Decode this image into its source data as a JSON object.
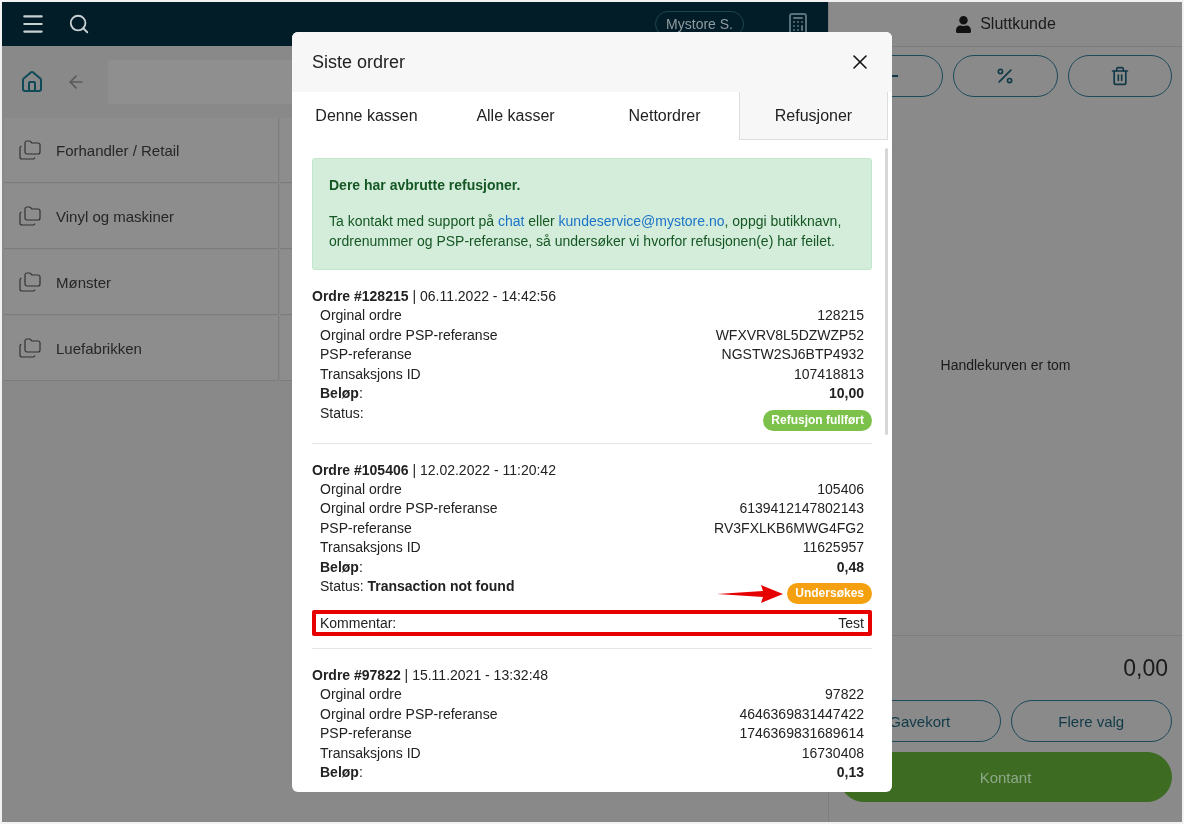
{
  "topbar": {
    "store_button": "Mystore S."
  },
  "categories": [
    {
      "label": "Forhandler / Retail"
    },
    {
      "label": "Vinyl og maskiner"
    },
    {
      "label": "Mønster"
    },
    {
      "label": "Luefabrikken"
    }
  ],
  "cart": {
    "customer": "Sluttkunde",
    "empty_message": "Handlekurven er tom",
    "total": "0,00",
    "buttons": [
      {
        "label": "Gavekort",
        "kind": "outline"
      },
      {
        "label": "Flere valg",
        "kind": "outline"
      },
      {
        "label": "Kontant",
        "kind": "primary"
      }
    ]
  },
  "modal": {
    "title": "Siste ordrer",
    "tabs": [
      {
        "label": "Denne kassen",
        "selected": false
      },
      {
        "label": "Alle kasser",
        "selected": false
      },
      {
        "label": "Nettordrer",
        "selected": false
      },
      {
        "label": "Refusjoner",
        "selected": true
      }
    ],
    "alert": {
      "title": "Dere har avbrutte refusjoner.",
      "message": [
        {
          "kind": "text",
          "text": "Ta kontakt med support på "
        },
        {
          "kind": "link",
          "text": "chat"
        },
        {
          "kind": "text",
          "text": " eller "
        },
        {
          "kind": "link",
          "text": "kundeservice@mystore.no"
        },
        {
          "kind": "text",
          "text": ", oppgi butikknavn, ordrenummer og PSP-referanse, så undersøker vi hvorfor refusjonen(e) har feilet."
        }
      ]
    },
    "orders": [
      {
        "header": "**Ordre #128215** | 06.11.2022 - 14:42:56",
        "rows": [
          {
            "label": "Orginal ordre",
            "value": "128215",
            "kind": "plain"
          },
          {
            "label": "Orginal ordre PSP-referanse",
            "value": "WFXVRV8L5DZWZP52",
            "kind": "plain"
          },
          {
            "label": "PSP-referanse",
            "value": "NGSTW2SJ6BTP4932",
            "kind": "plain"
          },
          {
            "label": "Transaksjons ID",
            "value": "107418813",
            "kind": "plain"
          },
          {
            "label": "**Beløp**:",
            "value": "10,00",
            "kind": "amount"
          }
        ],
        "status": {
          "label": "Status:",
          "badge": "Refusjon fullført",
          "color": "#7cc24a",
          "arrow": false
        }
      },
      {
        "header": "**Ordre #105406** | 12.02.2022 - 11:20:42",
        "rows": [
          {
            "label": "Orginal ordre",
            "value": "105406",
            "kind": "plain"
          },
          {
            "label": "Orginal ordre PSP-referanse",
            "value": "6139412147802143",
            "kind": "plain"
          },
          {
            "label": "PSP-referanse",
            "value": "RV3FXLKB6MWG4FG2",
            "kind": "plain"
          },
          {
            "label": "Transaksjons ID",
            "value": "11625957",
            "kind": "plain"
          },
          {
            "label": "**Beløp**:",
            "value": "0,48",
            "kind": "amount"
          }
        ],
        "status": {
          "label": "Status: **Transaction not found**",
          "badge": "Undersøkes",
          "color": "#f5a00f",
          "arrow": true
        },
        "comment": {
          "label": "Kommentar:",
          "value": "Test",
          "highlighted": true
        }
      },
      {
        "header": "**Ordre #97822** | 15.11.2021 - 13:32:48",
        "rows": [
          {
            "label": "Orginal ordre",
            "value": "97822",
            "kind": "plain"
          },
          {
            "label": "Orginal ordre PSP-referanse",
            "value": "4646369831447422",
            "kind": "plain"
          },
          {
            "label": "PSP-referanse",
            "value": "1746369831689614",
            "kind": "plain"
          },
          {
            "label": "Transaksjons ID",
            "value": "16730408",
            "kind": "plain"
          },
          {
            "label": "**Beløp**:",
            "value": "0,13",
            "kind": "amount"
          }
        ]
      }
    ]
  }
}
